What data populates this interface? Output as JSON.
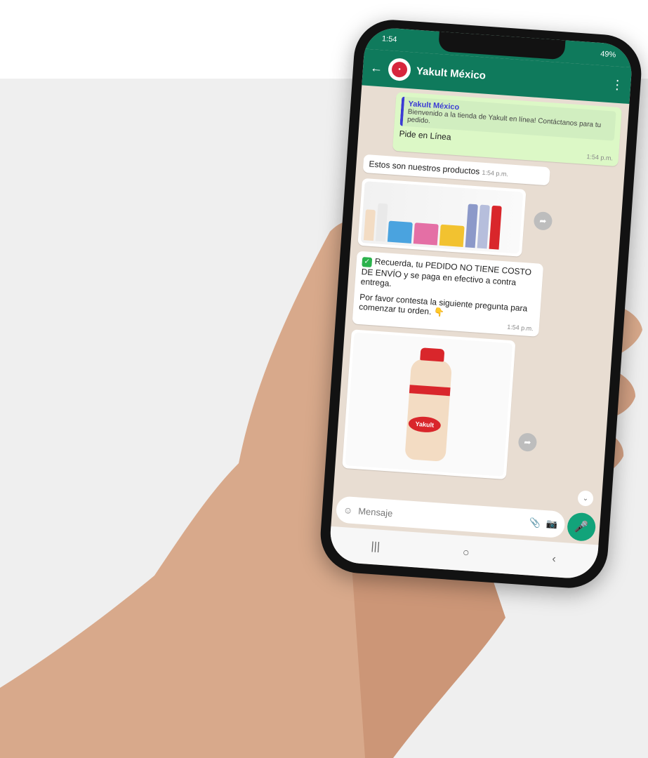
{
  "status": {
    "time": "1:54",
    "right": "49%"
  },
  "header": {
    "contact": "Yakult México"
  },
  "messages": {
    "quoted_title": "Yakult México",
    "quoted_text": "Bienvenido a la tienda de Yakult en línea! Contáctanos para tu pedido.",
    "order_line": "Pide en Línea",
    "order_time": "1:54 p.m.",
    "products_text": "Estos son nuestros productos",
    "products_time": "1:54 p.m.",
    "reminder_text": "Recuerda, tu PEDIDO NO TIENE COSTO DE ENVÍO y se paga en efectivo a contra entrega.",
    "question_text": "Por favor contesta la siguiente pregunta para comenzar tu orden. 👇",
    "reminder_time": "1:54 p.m.",
    "bottle_logo": "Yakult"
  },
  "input": {
    "placeholder": "Mensaje"
  },
  "nav": {
    "recent": "|||",
    "home": "○",
    "back": "‹"
  },
  "colors": {
    "whatsapp_green": "#0f7a5c",
    "bubble_out": "#dcf8c6",
    "yakult_red": "#d9262b"
  }
}
